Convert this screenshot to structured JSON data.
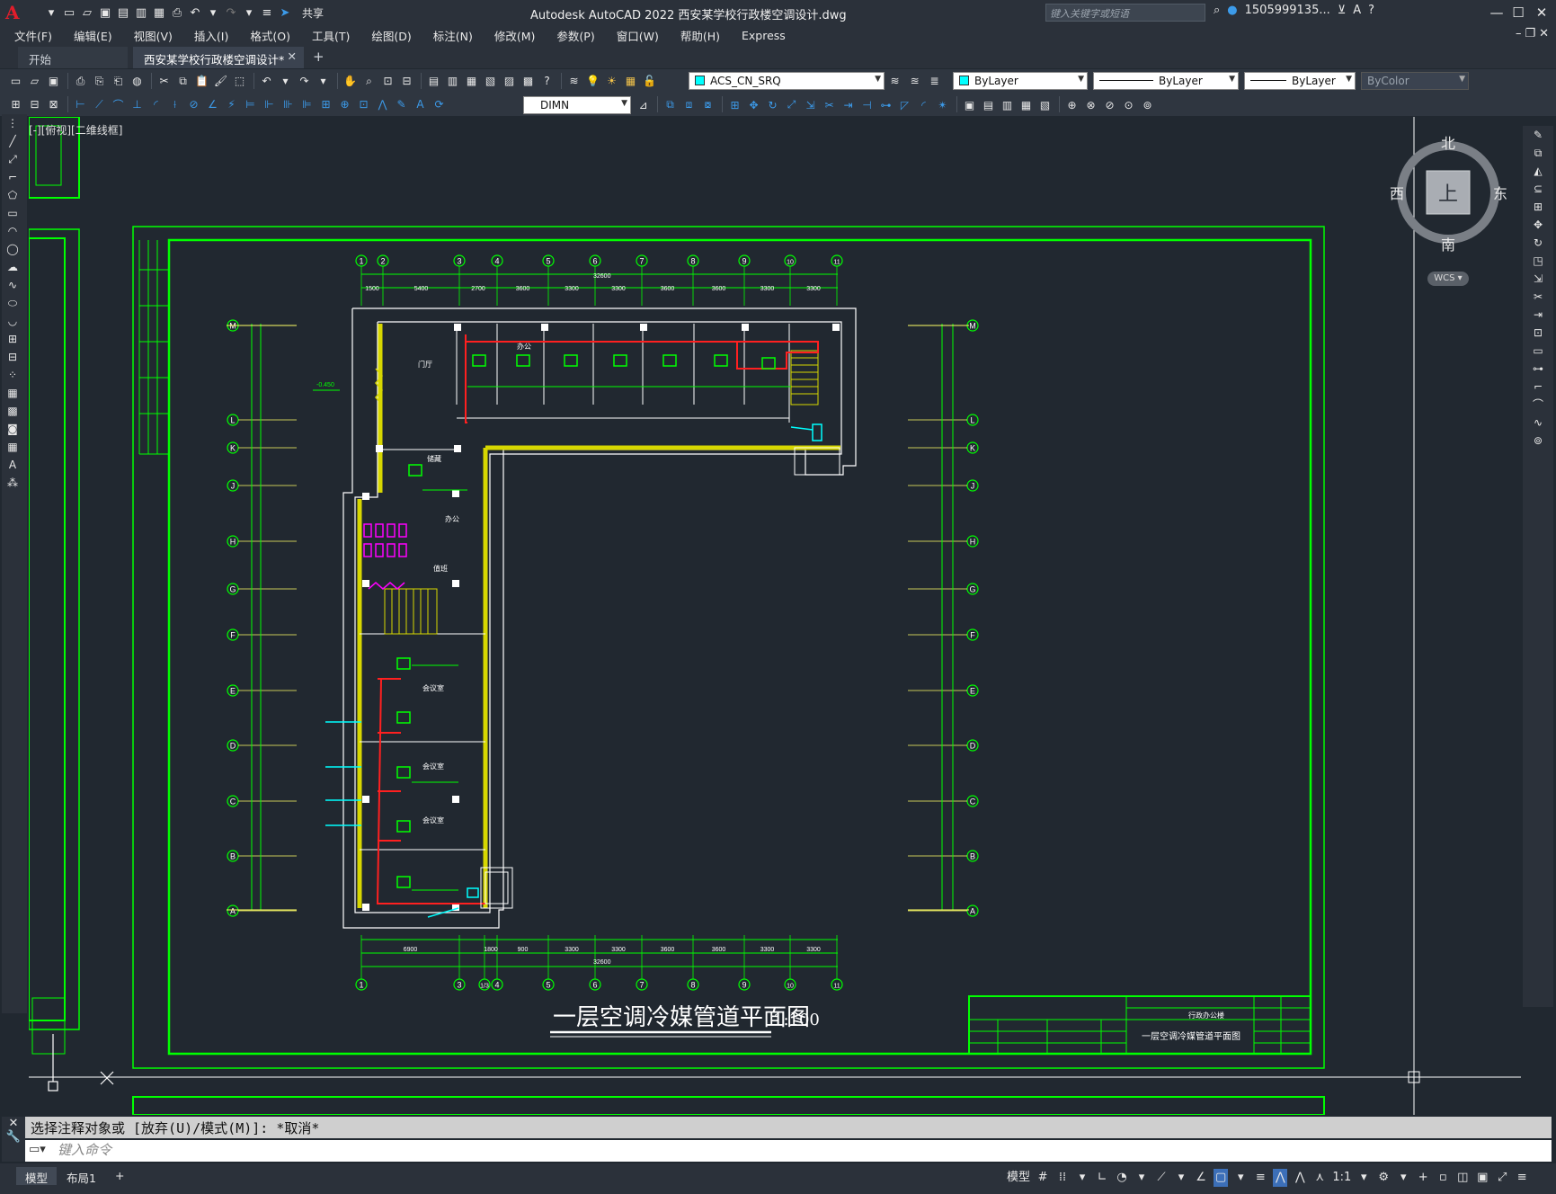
{
  "app": {
    "title": "Autodesk AutoCAD 2022    西安某学校行政楼空调设计.dwg",
    "share": "共享",
    "search_placeholder": "键入关键字或短语",
    "user": "1505999135...",
    "view_label": "[-][俯视][二维线框]"
  },
  "menus": [
    "文件(F)",
    "编辑(E)",
    "视图(V)",
    "插入(I)",
    "格式(O)",
    "工具(T)",
    "绘图(D)",
    "标注(N)",
    "修改(M)",
    "参数(P)",
    "窗口(W)",
    "帮助(H)",
    "Express"
  ],
  "tabs": {
    "start": "开始",
    "active": "西安某学校行政楼空调设计*"
  },
  "toolbar": {
    "layer": "ACS_CN_SRQ",
    "color": "ByLayer",
    "linetype": "ByLayer",
    "lineweight": "ByLayer",
    "plotstyle": "ByColor",
    "dimstyle": "DIMN"
  },
  "viewcube": {
    "north": "北",
    "south": "南",
    "east": "东",
    "west": "西",
    "face": "上",
    "wcs": "WCS"
  },
  "drawing": {
    "title": "一层空调冷媒管道平面图",
    "scale": "1:100",
    "rooms": [
      "门厅",
      "储藏",
      "办公",
      "会议室",
      "办公",
      "值班",
      "会议室",
      "会议室"
    ],
    "axes_top": [
      "1",
      "2",
      "3",
      "4",
      "5",
      "6",
      "7",
      "8",
      "9",
      "10",
      "11"
    ],
    "axes_bottom": [
      "1",
      "3",
      "1/3",
      "4",
      "5",
      "6",
      "7",
      "8",
      "9",
      "10",
      "11"
    ],
    "axes_rows": [
      "M",
      "L",
      "K",
      "J",
      "H",
      "G",
      "F",
      "E",
      "D",
      "C",
      "B",
      "A"
    ],
    "dims_top": [
      "1500",
      "5400",
      "2700",
      "3600",
      "3300",
      "3300",
      "3600",
      "3600",
      "3300",
      "3300"
    ],
    "dims_bottom": [
      "6900",
      "1800",
      "900",
      "3300",
      "3300",
      "3600",
      "3600",
      "3300",
      "3300"
    ],
    "total_dim": "32600",
    "elevation": "-0.450",
    "titleblock": {
      "project": "行政办公楼",
      "sheet": "一层空调冷媒管道平面图"
    }
  },
  "command": {
    "history": "选择注释对象或 [放弃(U)/模式(M)]: *取消*",
    "placeholder": "键入命令"
  },
  "status": {
    "model_tab": "模型",
    "layout_tab": "布局1",
    "model_btn": "模型",
    "scale": "1:1"
  }
}
